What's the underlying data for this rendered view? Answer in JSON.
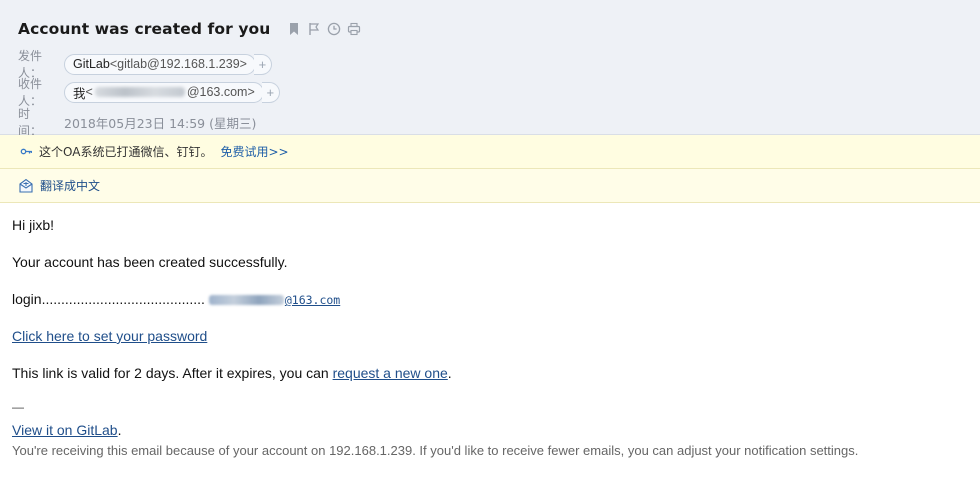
{
  "header": {
    "subject": "Account was created for you",
    "icons": [
      "bookmark-icon",
      "flag-icon",
      "clock-icon",
      "print-icon"
    ],
    "from_label": "发件人：",
    "from_name": "GitLab",
    "from_address": "<gitlab@192.168.1.239>",
    "to_label": "收件人：",
    "to_name": "我",
    "to_address_prefix": "<",
    "to_address_suffix": "@163.com>",
    "add_contact": "+",
    "time_label": "时　间：",
    "time_value": "2018年05月23日 14:59 (星期三)"
  },
  "banner": {
    "text": "这个OA系统已打通微信、钉钉。",
    "link": "免费试用>>"
  },
  "translate": {
    "link": "翻译成中文"
  },
  "message": {
    "greeting": "Hi jixb!",
    "created": "Your account has been created successfully.",
    "login_label": "login..........................................",
    "login_email_suffix": "@163.com",
    "set_password_link": "Click here to set your password",
    "valid_prefix": "This link is valid for 2 days. After it expires, you can ",
    "request_link": "request a new one",
    "valid_suffix": ".",
    "dash": "—",
    "view_link": "View it on GitLab",
    "view_suffix": ".",
    "reason": "You're receiving this email because of your account on 192.168.1.239. If you'd like to receive fewer emails, you can adjust your notification settings."
  },
  "colors": {
    "header_bg": "#eef1f6",
    "banner_bg": "#fffde1",
    "link": "#1f4e8a"
  }
}
